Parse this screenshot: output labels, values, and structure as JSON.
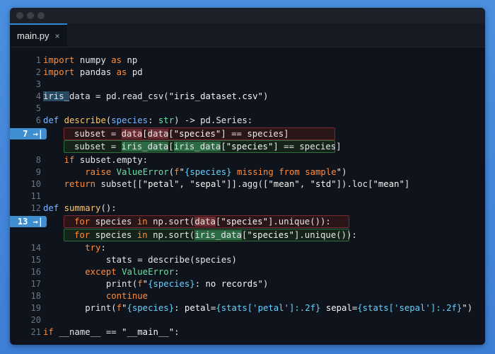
{
  "window": {
    "tab": {
      "label": "main.py",
      "close_glyph": "×"
    }
  },
  "editor": {
    "lines": [
      {
        "n": "1",
        "text": "import numpy as np"
      },
      {
        "n": "2",
        "text": "import pandas as pd"
      },
      {
        "n": "3",
        "text": ""
      },
      {
        "n": "4",
        "text": "iris_data = pd.read_csv(\"iris_dataset.csv\")"
      },
      {
        "n": "5",
        "text": ""
      },
      {
        "n": "6",
        "text": "def describe(species: str) -> pd.Series:"
      },
      {
        "n": "7",
        "marker": "7 →|",
        "removed": "subset = data[data[\"species\"] == species]",
        "added": "subset = iris_data[iris_data[\"species\"] == species]"
      },
      {
        "n": "8",
        "text": "    if subset.empty:"
      },
      {
        "n": "9",
        "text": "        raise ValueError(f\"{species} missing from sample\")"
      },
      {
        "n": "10",
        "text": "    return subset[[\"petal\", \"sepal\"]].agg([\"mean\", \"std\"]).loc[\"mean\"]"
      },
      {
        "n": "11",
        "text": ""
      },
      {
        "n": "12",
        "text": "def summary():"
      },
      {
        "n": "13",
        "marker": "13 →|",
        "removed": "for species in np.sort(data[\"species\"].unique()):",
        "added": "for species in np.sort(iris_data[\"species\"].unique()):"
      },
      {
        "n": "14",
        "text": "        try:"
      },
      {
        "n": "15",
        "text": "            stats = describe(species)"
      },
      {
        "n": "16",
        "text": "        except ValueError:"
      },
      {
        "n": "17",
        "text": "            print(f\"{species}: no records\")"
      },
      {
        "n": "18",
        "text": "            continue"
      },
      {
        "n": "19",
        "text": "        print(f\"{species}: petal={stats['petal']:.2f} sepal={stats['sepal']:.2f}\")"
      },
      {
        "n": "20",
        "text": ""
      },
      {
        "n": "21",
        "text": "if __name__ == \"__main__\":"
      }
    ]
  },
  "colors": {
    "background": "#3d7fd6",
    "editor_bg": "#0f141c",
    "keyword": "#ff8c3a",
    "function": "#ffc56a",
    "type": "#6ee0a1",
    "removed_box": "#7a2a2f",
    "added_box": "#2f6f3d",
    "marker": "#3e8ed0"
  }
}
